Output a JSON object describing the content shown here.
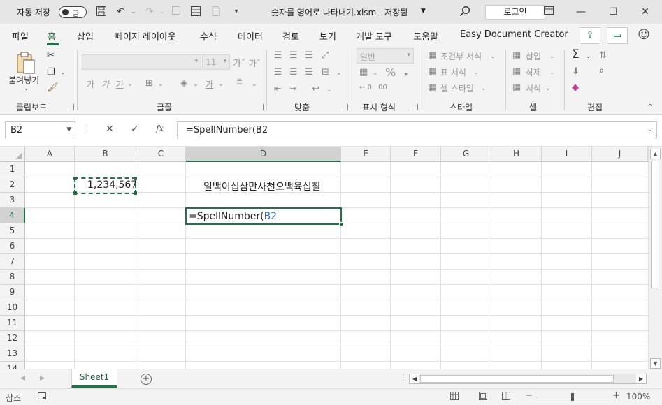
{
  "titlebar": {
    "autosave_label": "자동 저장",
    "autosave_state": "끔",
    "document_title": "숫자를 영어로 나타내기.xlsm - 저장됨",
    "login_label": "로그인"
  },
  "ribbon_tabs": [
    "파일",
    "홈",
    "삽입",
    "페이지 레이아웃",
    "수식",
    "데이터",
    "검토",
    "보기",
    "개발 도구",
    "도움말",
    "Easy Document Creator"
  ],
  "active_tab": "홈",
  "ribbon": {
    "clipboard": {
      "paste_label": "붙여넣기",
      "group_label": "클립보드"
    },
    "font": {
      "font_name": "",
      "font_size": "11",
      "group_label": "글꼴",
      "bold": "가",
      "italic": "가",
      "underline": "가",
      "font_color": "가"
    },
    "align": {
      "group_label": "맞춤"
    },
    "number": {
      "format": "일반",
      "group_label": "표시 형식",
      "percent": "%"
    },
    "styles": {
      "conditional": "조건부 서식",
      "table": "표 서식",
      "cell_style": "셀 스타일",
      "group_label": "스타일"
    },
    "cells": {
      "insert": "삽입",
      "delete": "삭제",
      "format": "서식",
      "group_label": "셀"
    },
    "editing": {
      "group_label": "편집"
    }
  },
  "formula_bar": {
    "name_box": "B2",
    "fx_label": "fx",
    "formula": "=SpellNumber(B2"
  },
  "grid": {
    "columns": [
      "A",
      "B",
      "C",
      "D",
      "E",
      "F",
      "G",
      "H",
      "I",
      "J"
    ],
    "rows": [
      "1",
      "2",
      "3",
      "4",
      "5",
      "6",
      "7",
      "8",
      "9",
      "10",
      "11",
      "12",
      "13",
      "14"
    ],
    "cells": {
      "B2": "1,234,567",
      "D2": "일백이십삼만사천오백육십칠",
      "D4_prefix": "=SpellNumber(",
      "D4_ref": "B2"
    }
  },
  "sheet_tabs": [
    "Sheet1"
  ],
  "statusbar": {
    "mode": "참조",
    "zoom": "100%"
  },
  "colors": {
    "accent": "#217346",
    "reference": "#2f6fbf"
  }
}
